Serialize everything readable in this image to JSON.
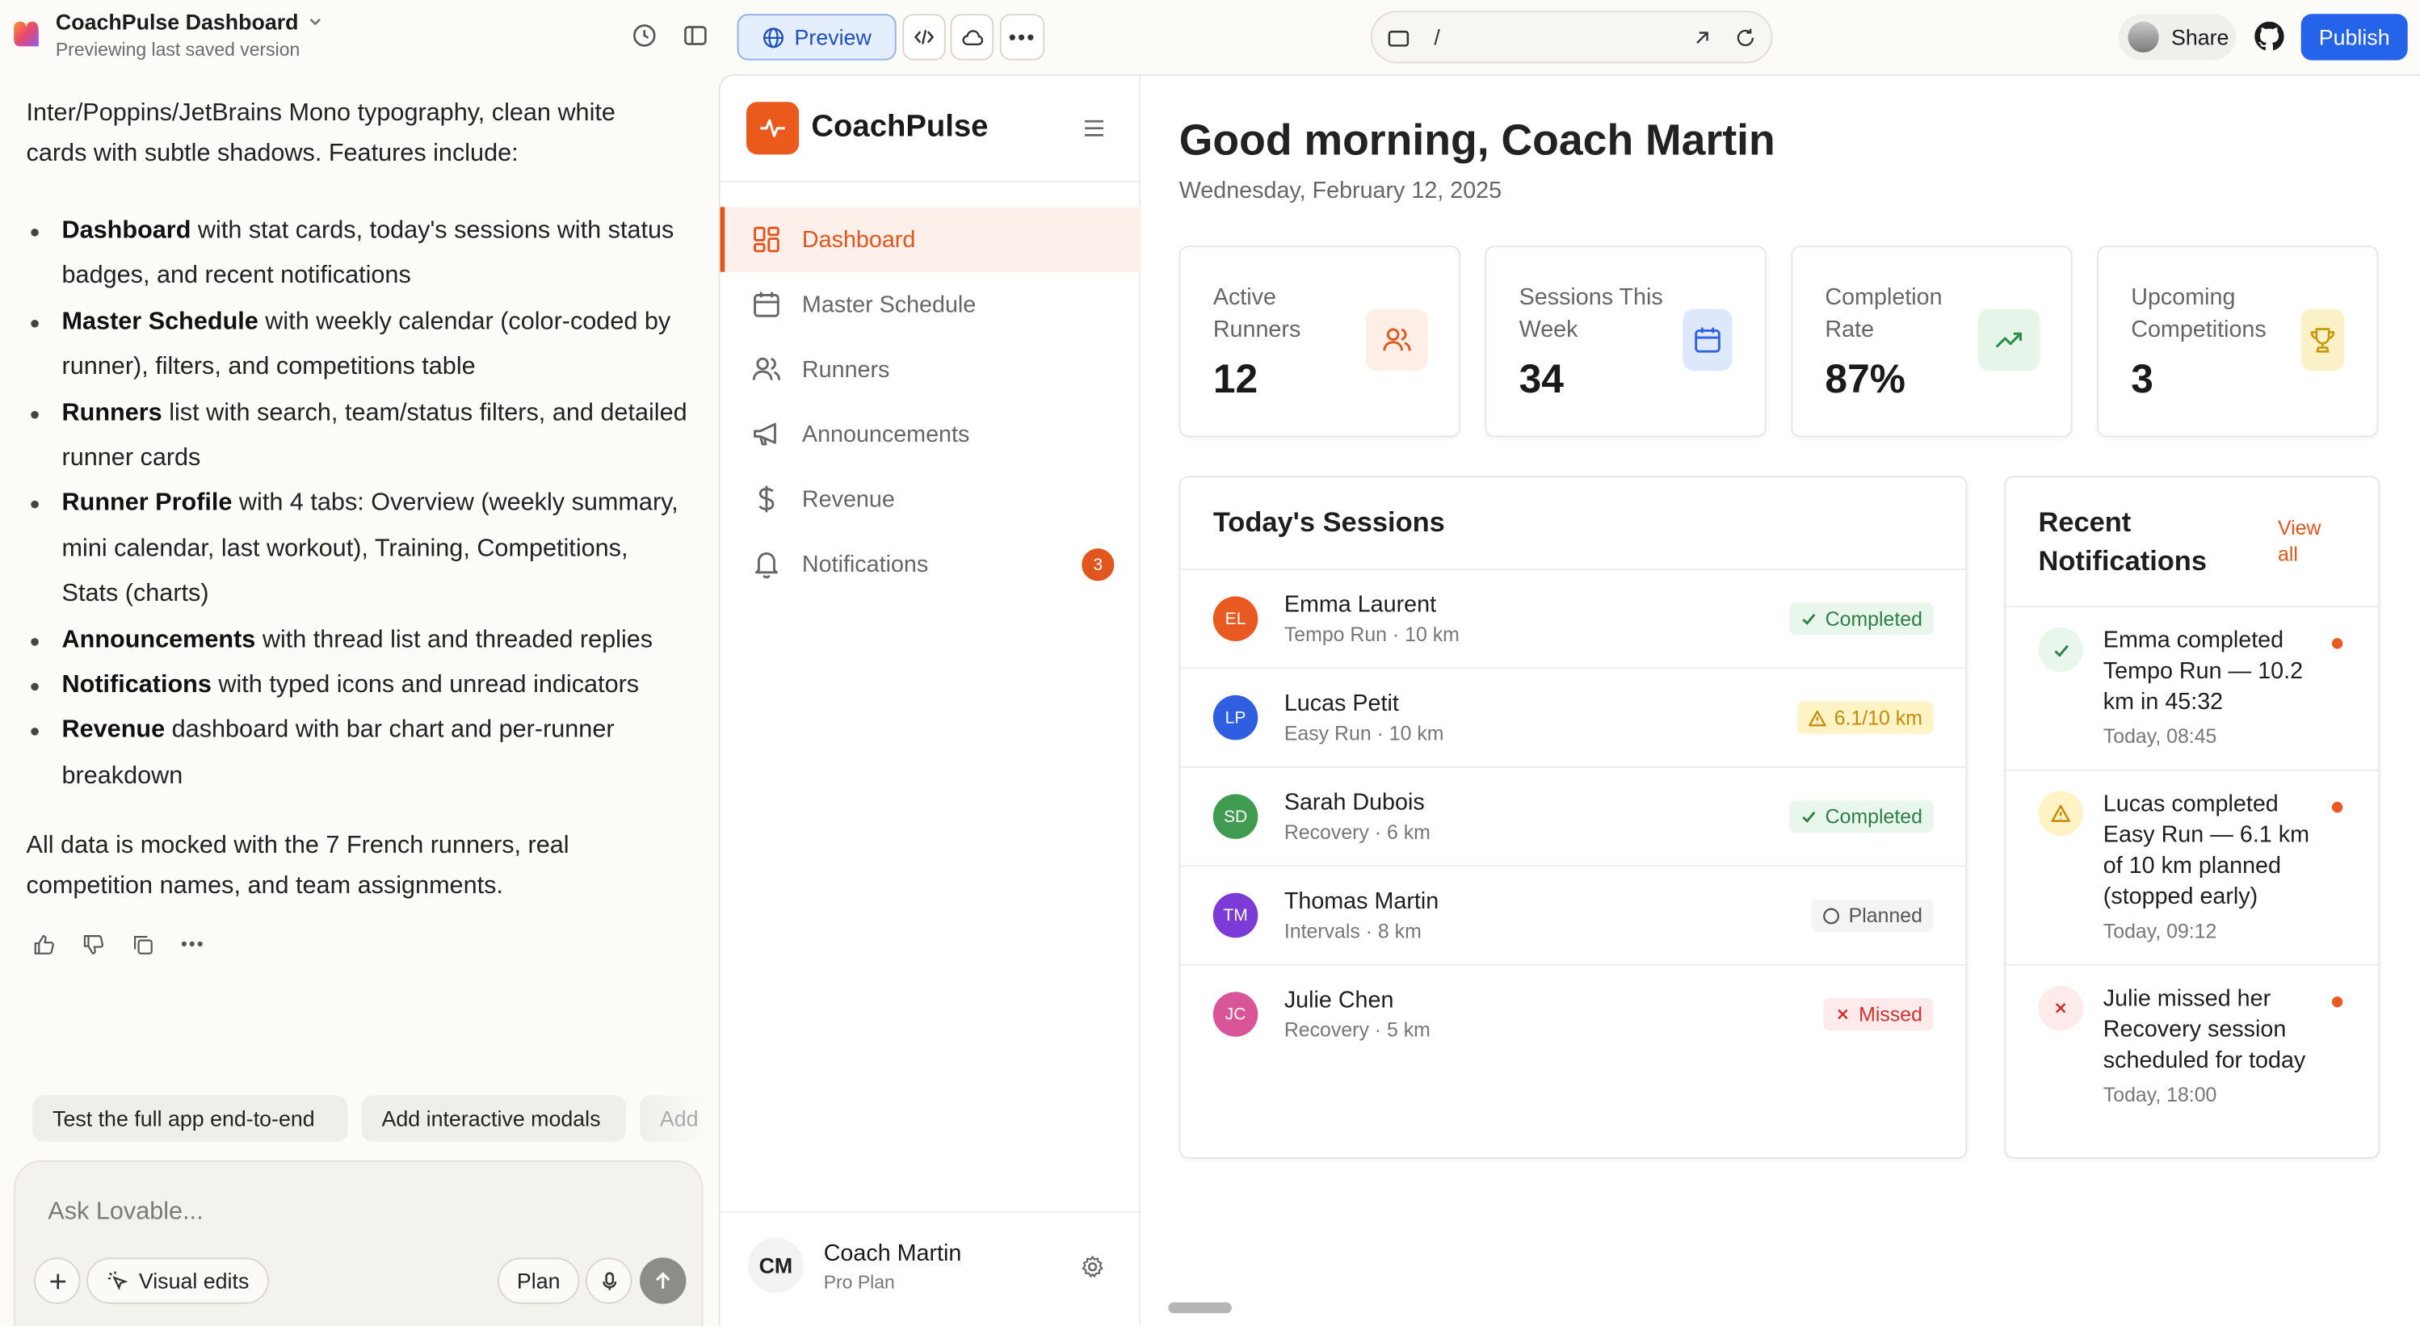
{
  "topbar": {
    "project_title": "CoachPulse Dashboard",
    "project_subtitle": "Previewing last saved version",
    "preview_label": "Preview",
    "url_path": "/",
    "share_label": "Share",
    "publish_label": "Publish",
    "publish_color": "#2563eb"
  },
  "chat": {
    "intro": "Inter/Poppins/JetBrains Mono typography, clean white cards with subtle shadows. Features include:",
    "bullets": [
      {
        "bold": "Dashboard",
        "text": " with stat cards, today's sessions with status badges, and recent notifications"
      },
      {
        "bold": "Master Schedule",
        "text": " with weekly calendar (color-coded by runner), filters, and competitions table"
      },
      {
        "bold": "Runners",
        "text": " list with search, team/status filters, and detailed runner cards"
      },
      {
        "bold": "Runner Profile",
        "text": " with 4 tabs: Overview (weekly summary, mini calendar, last workout), Training, Competitions, Stats (charts)"
      },
      {
        "bold": "Announcements",
        "text": " with thread list and threaded replies"
      },
      {
        "bold": "Notifications",
        "text": " with typed icons and unread indicators"
      },
      {
        "bold": "Revenue",
        "text": " dashboard with bar chart and per-runner breakdown"
      }
    ],
    "outro": "All data is mocked with the 7 French runners, real competition names, and team assignments.",
    "suggestions": [
      "Test the full app end-to-end",
      "Add interactive modals",
      "Add"
    ],
    "input_placeholder": "Ask Lovable...",
    "visual_edits_label": "Visual edits",
    "plan_label": "Plan"
  },
  "app": {
    "brand": "CoachPulse",
    "accent_color": "#e0561c",
    "nav": [
      {
        "label": "Dashboard",
        "icon": "grid-icon",
        "active": true
      },
      {
        "label": "Master Schedule",
        "icon": "calendar-icon"
      },
      {
        "label": "Runners",
        "icon": "users-icon"
      },
      {
        "label": "Announcements",
        "icon": "megaphone-icon"
      },
      {
        "label": "Revenue",
        "icon": "dollar-icon"
      },
      {
        "label": "Notifications",
        "icon": "bell-icon",
        "badge": "3"
      }
    ],
    "user": {
      "initials": "CM",
      "name": "Coach Martin",
      "plan": "Pro Plan"
    },
    "greeting": "Good morning, Coach Martin",
    "date": "Wednesday, February 12, 2025",
    "stats": [
      {
        "label": "Active Runners",
        "value": "12",
        "icon": "users-icon"
      },
      {
        "label": "Sessions This Week",
        "value": "34",
        "icon": "calendar-icon"
      },
      {
        "label": "Completion Rate",
        "value": "87%",
        "icon": "trending-up-icon"
      },
      {
        "label": "Upcoming Competitions",
        "value": "3",
        "icon": "trophy-icon"
      }
    ],
    "sessions_title": "Today's Sessions",
    "sessions": [
      {
        "initials": "EL",
        "name": "Emma Laurent",
        "detail": "Tempo Run · 10 km",
        "status": "Completed",
        "avatar_color": "#e85a22"
      },
      {
        "initials": "LP",
        "name": "Lucas Petit",
        "detail": "Easy Run · 10 km",
        "status": "6.1/10 km",
        "avatar_color": "#2f5fe0"
      },
      {
        "initials": "SD",
        "name": "Sarah Dubois",
        "detail": "Recovery · 6 km",
        "status": "Completed",
        "avatar_color": "#3e9b4f"
      },
      {
        "initials": "TM",
        "name": "Thomas Martin",
        "detail": "Intervals · 8 km",
        "status": "Planned",
        "avatar_color": "#7c3ad6"
      },
      {
        "initials": "JC",
        "name": "Julie Chen",
        "detail": "Recovery · 5 km",
        "status": "Missed",
        "avatar_color": "#d9559a"
      }
    ],
    "notifications_title": "Recent Notifications",
    "view_all": "View all",
    "notifications": [
      {
        "text": "Emma completed Tempo Run — 10.2 km in 45:32",
        "time": "Today, 08:45",
        "type": "success"
      },
      {
        "text": "Lucas completed Easy Run — 6.1 km of 10 km planned (stopped early)",
        "time": "Today, 09:12",
        "type": "warning"
      },
      {
        "text": "Julie missed her Recovery session scheduled for today",
        "time": "Today, 18:00",
        "type": "error"
      }
    ]
  }
}
